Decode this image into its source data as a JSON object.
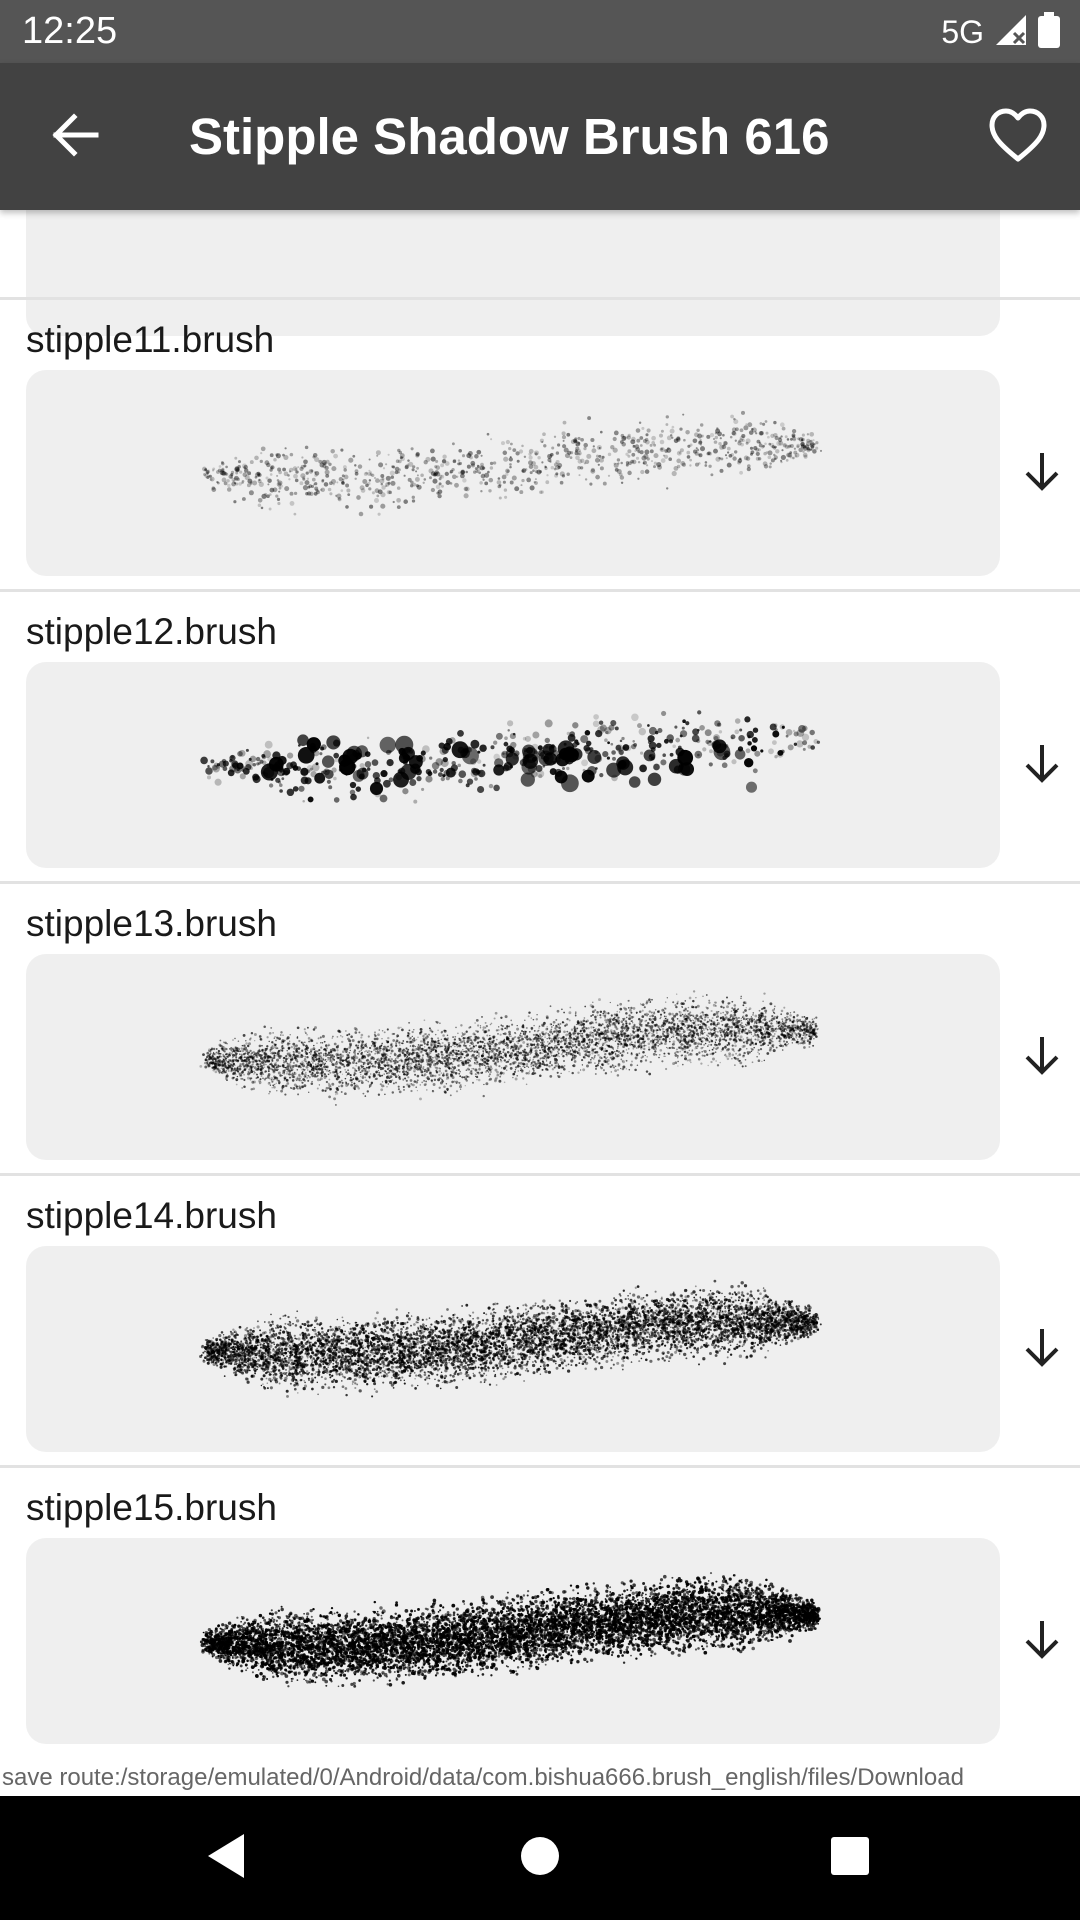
{
  "status_bar": {
    "time": "12:25",
    "network": "5G",
    "icons": [
      "signal-icon",
      "battery-icon"
    ]
  },
  "app_bar": {
    "title": "Stipple Shadow Brush 616",
    "back_icon": "arrow-back-icon",
    "favorite_icon": "heart-outline-icon"
  },
  "brushes": [
    {
      "name": "stipple11.brush",
      "style": "light-scatter"
    },
    {
      "name": "stipple12.brush",
      "style": "large-dots"
    },
    {
      "name": "stipple13.brush",
      "style": "fine-stipple"
    },
    {
      "name": "stipple14.brush",
      "style": "medium-stipple"
    },
    {
      "name": "stipple15.brush",
      "style": "dense-stipple"
    }
  ],
  "download_icon": "arrow-down-icon",
  "save_route": "save route:/storage/emulated/0/Android/data/com.bishua666.brush_english/files/Download",
  "nav_bar": {
    "back_icon": "triangle-back-icon",
    "home_icon": "circle-home-icon",
    "recents_icon": "square-recents-icon"
  },
  "colors": {
    "app_bar": "#424242",
    "status_bar": "#555555",
    "preview_bg": "#efefef"
  }
}
